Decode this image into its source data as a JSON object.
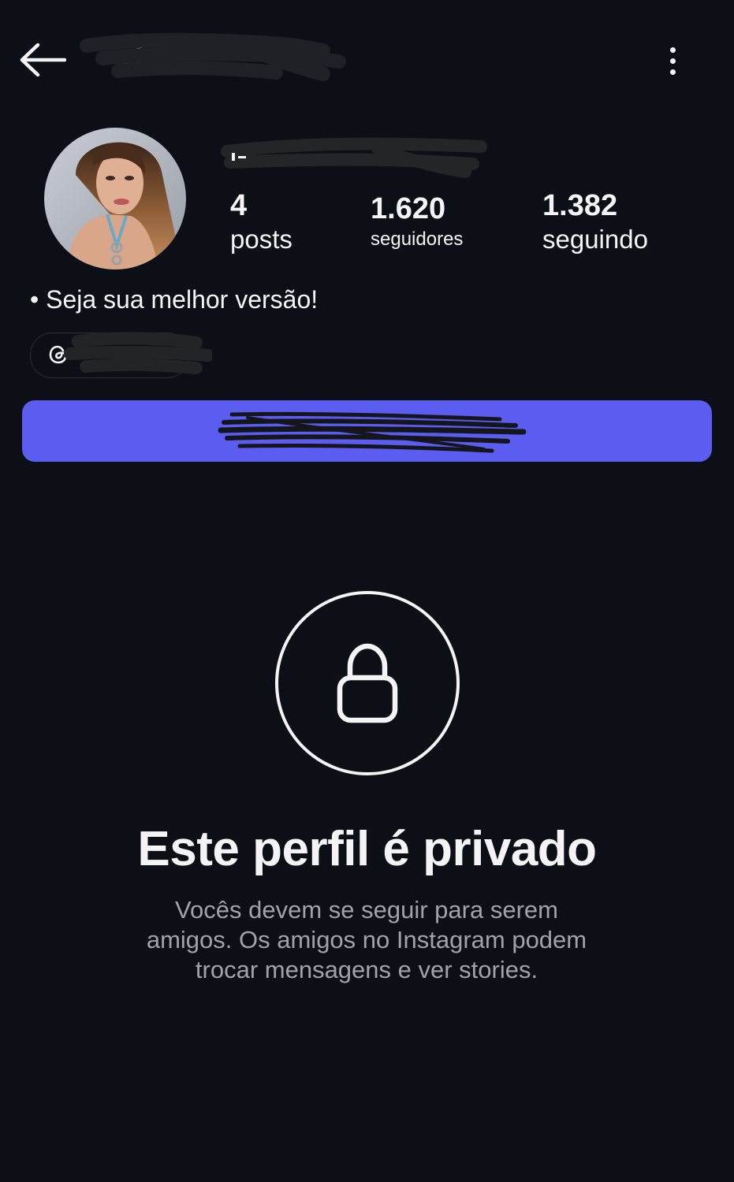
{
  "header": {
    "username": "d",
    "back_icon": "arrow-left-icon",
    "menu_icon": "more-vertical-icon"
  },
  "profile": {
    "display_name": "",
    "bio": "• Seja sua melhor versão!",
    "threads_handle": "",
    "threads_icon": "threads-icon"
  },
  "stats": {
    "posts_count": "4",
    "posts_label": "posts",
    "followers_count": "1.620",
    "followers_label": "seguidores",
    "following_count": "1.382",
    "following_label": "seguindo"
  },
  "actions": {
    "follow_label": ""
  },
  "private_notice": {
    "icon": "lock-icon",
    "title": "Este perfil é privado",
    "description": "Vocês devem se seguir para serem amigos. Os amigos no Instagram podem trocar mensagens e ver stories."
  },
  "colors": {
    "background": "#0c1016",
    "accent": "#5b5cf0",
    "text": "#f4f4f6",
    "muted_text": "#a0a3aa"
  }
}
